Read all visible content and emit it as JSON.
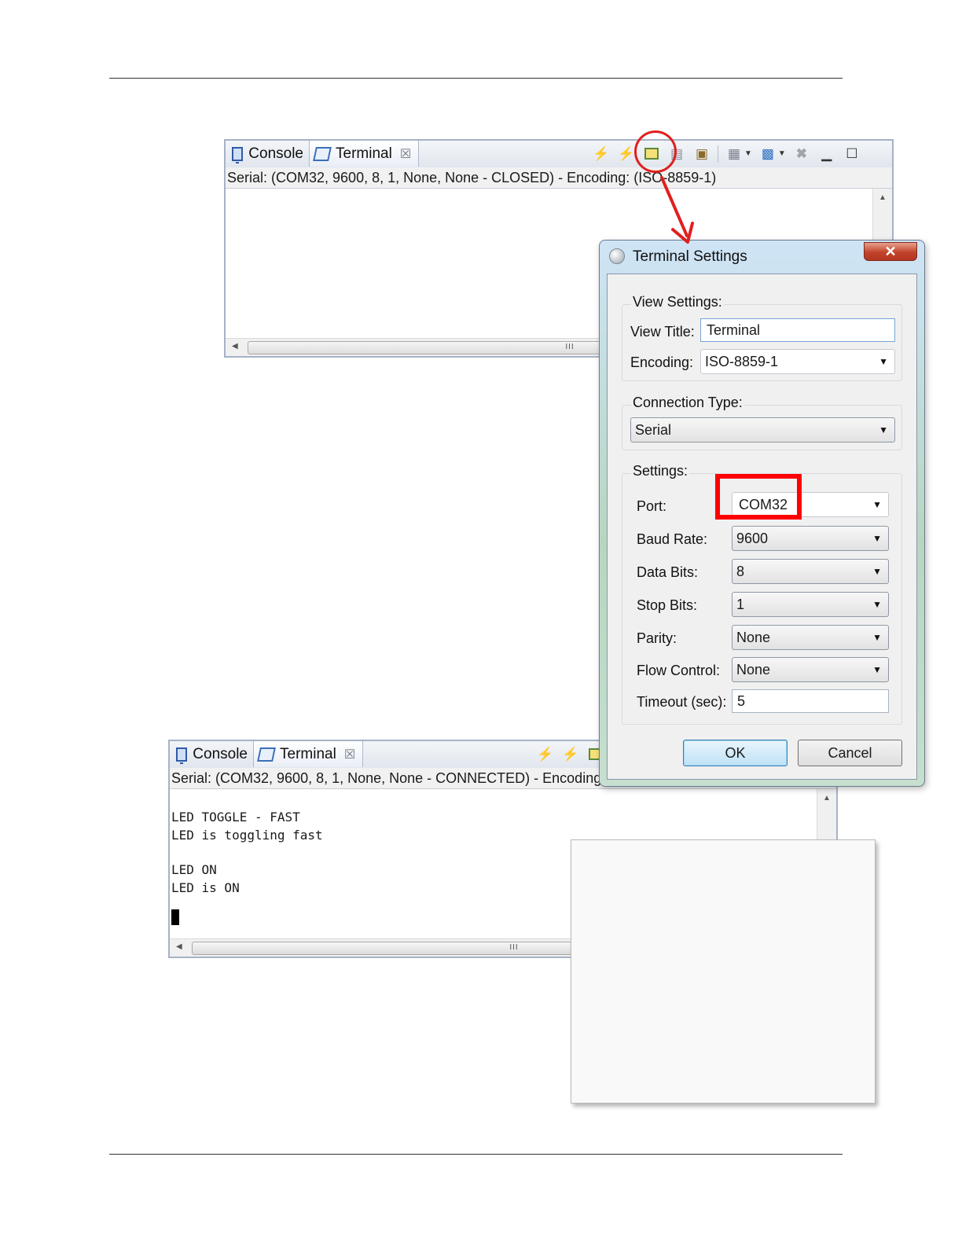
{
  "top_view": {
    "tabs": {
      "console": "Console",
      "terminal": "Terminal"
    },
    "status": "Serial: (COM32, 9600, 8, 1, None, None - CLOSED) - Encoding: (ISO-8859-1)"
  },
  "bottom_view": {
    "tabs": {
      "console": "Console",
      "terminal": "Terminal"
    },
    "status": "Serial: (COM32, 9600, 8, 1, None, None - CONNECTED) - Encoding: (IS",
    "lines": [
      "LED TOGGLE - FAST",
      "LED is toggling fast",
      "LED ON",
      "LED is ON"
    ]
  },
  "dialog": {
    "title": "Terminal Settings",
    "close_glyph": "✕",
    "view_settings": {
      "group_label": "View Settings:",
      "view_title_label": "View Title:",
      "view_title_value": "Terminal",
      "encoding_label": "Encoding:",
      "encoding_value": "ISO-8859-1"
    },
    "connection_type": {
      "group_label": "Connection Type:",
      "value": "Serial"
    },
    "settings": {
      "group_label": "Settings:",
      "port_label": "Port:",
      "port_value": "COM32",
      "baud_label": "Baud Rate:",
      "baud_value": "9600",
      "data_bits_label": "Data Bits:",
      "data_bits_value": "8",
      "stop_bits_label": "Stop Bits:",
      "stop_bits_value": "1",
      "parity_label": "Parity:",
      "parity_value": "None",
      "flow_label": "Flow Control:",
      "flow_value": "None",
      "timeout_label": "Timeout (sec):",
      "timeout_value": "5"
    },
    "ok_label": "OK",
    "cancel_label": "Cancel"
  },
  "colors": {
    "annotation_red": "#e01f1f",
    "view_border": "#a6b3c6",
    "icon_green": "#2e9a2e"
  },
  "icons": {
    "connect": "connect-icon",
    "disconnect": "disconnect-icon",
    "settings": "terminal-settings-icon",
    "scroll_lock": "scroll-lock-icon",
    "clear": "clear-icon",
    "display": "display-selected-icon",
    "new_terminal": "new-terminal-icon",
    "remove": "remove-icon",
    "minimize": "minimize-icon",
    "maximize": "maximize-icon"
  }
}
